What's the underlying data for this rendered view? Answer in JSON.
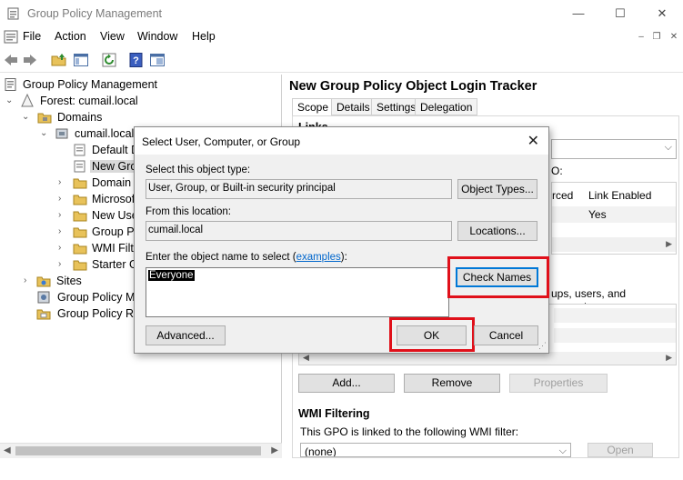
{
  "window": {
    "title": "Group Policy Management",
    "controls": {
      "minimize": "—",
      "maximize": "☐",
      "close": "✕"
    }
  },
  "menu": {
    "items": [
      "File",
      "Action",
      "View",
      "Window",
      "Help"
    ],
    "mdi": {
      "minimize": "–",
      "restore": "❐",
      "close": "✕"
    }
  },
  "tree": {
    "root": "Group Policy Management",
    "forest": "Forest: cumail.local",
    "domains": "Domains",
    "domain": "cumail.local",
    "items": [
      "Default D",
      "New Grou",
      "Domain",
      "Microsof",
      "New Use",
      "Group Po",
      "WMI Filte",
      "Starter G"
    ],
    "sites": "Sites",
    "modeling": "Group Policy Mo",
    "results": "Group Policy Re"
  },
  "right": {
    "title": "New Group Policy Object Login Tracker",
    "tabs": [
      "Scope",
      "Details",
      "Settings",
      "Delegation"
    ],
    "links_heading": "Links",
    "gpo_fragment": "O:",
    "col_enforced": "rced",
    "col_link_enabled": "Link Enabled",
    "link_enabled_value": "Yes",
    "security_fragment": "ups, users, and computers:",
    "buttons": {
      "add": "Add...",
      "remove": "Remove",
      "properties": "Properties"
    },
    "wmi_heading": "WMI Filtering",
    "wmi_text": "This GPO is linked to the following WMI filter:",
    "wmi_value": "(none)",
    "open": "Open"
  },
  "dialog": {
    "title": "Select User, Computer, or Group",
    "object_type_label": "Select this object type:",
    "object_type_value": "User, Group, or Built-in security principal",
    "object_types_button": "Object Types...",
    "location_label": "From this location:",
    "location_value": "cumail.local",
    "locations_button": "Locations...",
    "enter_label_prefix": "Enter the object name to select (",
    "examples_link": "examples",
    "enter_label_suffix": "):",
    "object_name": "Everyone",
    "check_names_button": "Check Names",
    "advanced_button": "Advanced...",
    "ok_button": "OK",
    "cancel_button": "Cancel",
    "close": "✕"
  },
  "colors": {
    "highlight": "#e0101a",
    "link": "#0066cc",
    "default_button_border": "#0078d7"
  }
}
